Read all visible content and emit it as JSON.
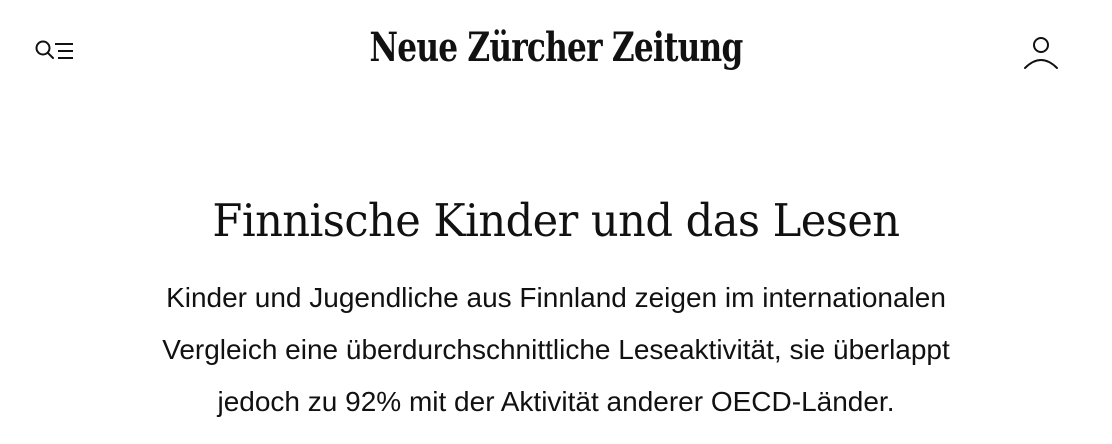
{
  "header": {
    "logo_text": "Neue Zürcher Zeitung",
    "menu_icon": "search-menu-icon",
    "user_icon": "user-icon"
  },
  "article": {
    "title": "Finnische Kinder und das Lesen",
    "lead_lines": [
      "Kinder und Jugendliche aus Finnland zeigen im internationalen",
      "Vergleich eine überdurchschnittliche Leseaktivität, sie überlappt",
      "jedoch zu 92% mit der Aktivität anderer OECD-Länder."
    ]
  }
}
